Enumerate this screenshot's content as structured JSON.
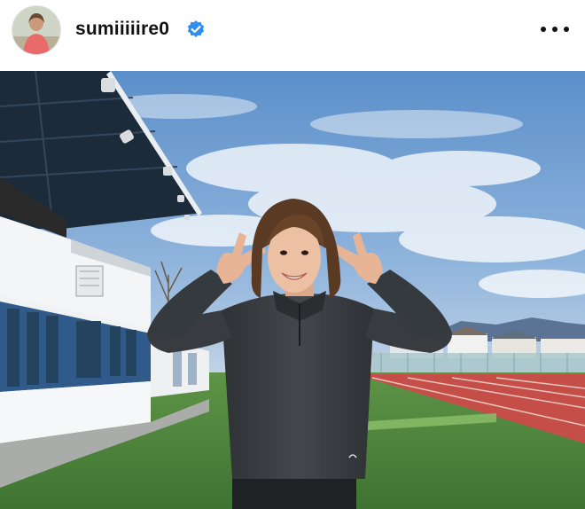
{
  "post": {
    "username": "sumiiiiire0",
    "verified": true,
    "more_icon": "more-horizontal-icon",
    "avatar_icon": "avatar-photo"
  },
  "colors": {
    "verified_badge": "#2f8ef0",
    "sky": "#6f9fd1",
    "track": "#c8504a",
    "grass": "#4f8a3d",
    "jacket": "#3a3d40"
  }
}
